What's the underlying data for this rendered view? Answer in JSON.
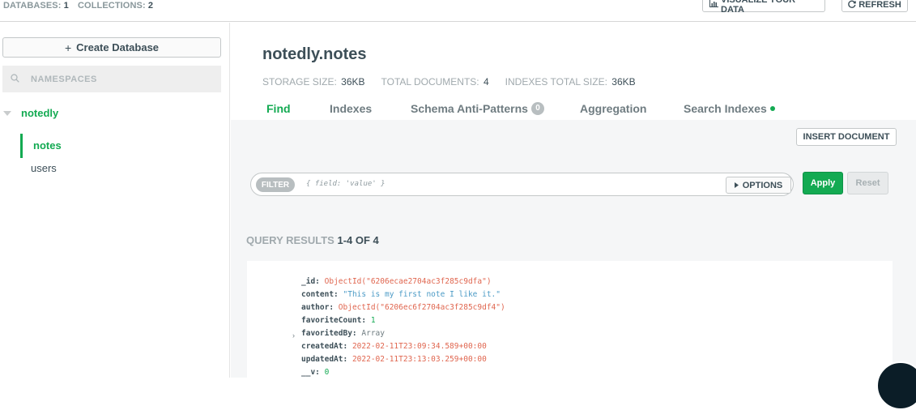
{
  "topbar": {
    "databases_label": "DATABASES:",
    "databases_count": "1",
    "collections_label": "COLLECTIONS:",
    "collections_count": "2",
    "visualize_label": "VISUALIZE YOUR DATA",
    "refresh_label": "REFRESH"
  },
  "sidebar": {
    "create_db_label": "Create Database",
    "search_placeholder": "NAMESPACES",
    "database": "notedly",
    "collections": [
      "notes",
      "users"
    ]
  },
  "main": {
    "namespace": "notedly.notes",
    "stats": {
      "storage_label": "STORAGE SIZE:",
      "storage_value": "36KB",
      "docs_label": "TOTAL DOCUMENTS:",
      "docs_value": "4",
      "indexes_label": "INDEXES TOTAL SIZE:",
      "indexes_value": "36KB"
    },
    "tabs": [
      "Find",
      "Indexes",
      "Schema Anti-Patterns",
      "Aggregation",
      "Search Indexes"
    ],
    "schema_badge": "0",
    "insert_label": "INSERT DOCUMENT",
    "filter_label": "FILTER",
    "filter_placeholder": "{ field: 'value' }",
    "options_label": "OPTIONS",
    "apply_label": "Apply",
    "reset_label": "Reset",
    "results_label": "QUERY RESULTS",
    "results_range": "1-4 OF 4",
    "document": [
      {
        "key": "_id",
        "value": "ObjectId(\"6206ecae2704ac3f285c9dfa\")",
        "type": "oid"
      },
      {
        "key": "content",
        "value": "\"This is my first note I like it.\"",
        "type": "str"
      },
      {
        "key": "author",
        "value": "ObjectId(\"6206ec6f2704ac3f285c9df4\")",
        "type": "oid"
      },
      {
        "key": "favoriteCount",
        "value": "1",
        "type": "num"
      },
      {
        "key": "favoritedBy",
        "value": "Array",
        "type": "arr"
      },
      {
        "key": "createdAt",
        "value": "2022-02-11T23:09:34.589+00:00",
        "type": "date"
      },
      {
        "key": "updatedAt",
        "value": "2022-02-11T23:13:03.259+00:00",
        "type": "date"
      },
      {
        "key": "__v",
        "value": "0",
        "type": "date"
      }
    ]
  },
  "colors": {
    "accent": "#13aa52",
    "text": "#3d4f58",
    "muted": "#a0a9ad",
    "workspace_bg": "#f5f6f7"
  }
}
